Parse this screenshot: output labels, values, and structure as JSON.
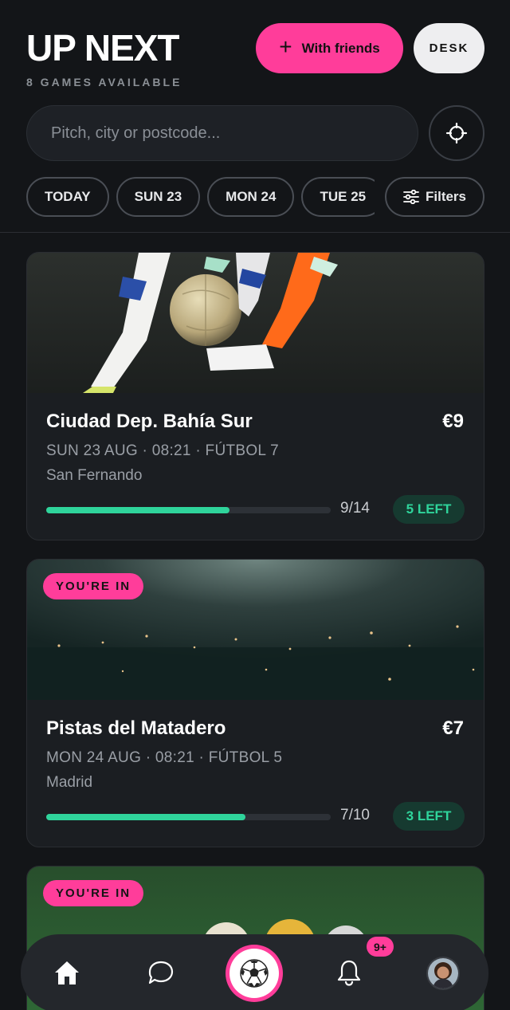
{
  "header": {
    "title": "UP NEXT",
    "subtitle": "8 GAMES AVAILABLE",
    "friends_button": {
      "icon": "plus-icon",
      "label": "With friends"
    },
    "desk_button": "DESK"
  },
  "search": {
    "placeholder": "Pitch, city or postcode...",
    "locate_icon": "crosshair-icon"
  },
  "date_chips": [
    "TODAY",
    "SUN 23",
    "MON 24",
    "TUE 25"
  ],
  "filters": {
    "icon": "sliders-icon",
    "label": "Filters"
  },
  "games": [
    {
      "badge": "",
      "image": "football-tackle-photo",
      "venue": "Ciudad Dep. Bahía Sur",
      "price": "€9",
      "meta": "SUN 23 AUG · 08:21 · FÚTBOL 7",
      "city": "San Fernando",
      "filled": 9,
      "capacity": 14,
      "count": "9/14",
      "spots_left": "5 LEFT"
    },
    {
      "badge": "YOU'RE IN",
      "image": "night-stadium-photo",
      "venue": "Pistas del Matadero",
      "price": "€7",
      "meta": "MON 24 AUG · 08:21 · FÚTBOL 5",
      "city": "Madrid",
      "filled": 7,
      "capacity": 10,
      "count": "7/10",
      "spots_left": "3 LEFT"
    },
    {
      "badge": "YOU'RE IN",
      "image": "grass-balls-photo"
    }
  ],
  "nav": {
    "items": [
      "home-icon",
      "chat-icon",
      "soccer-ball-icon",
      "bell-icon",
      "avatar"
    ],
    "notification_count": "9+"
  },
  "colors": {
    "accent": "#ff3d9a",
    "progress": "#2fd49b",
    "background": "#131518",
    "card": "#1b1e22"
  }
}
